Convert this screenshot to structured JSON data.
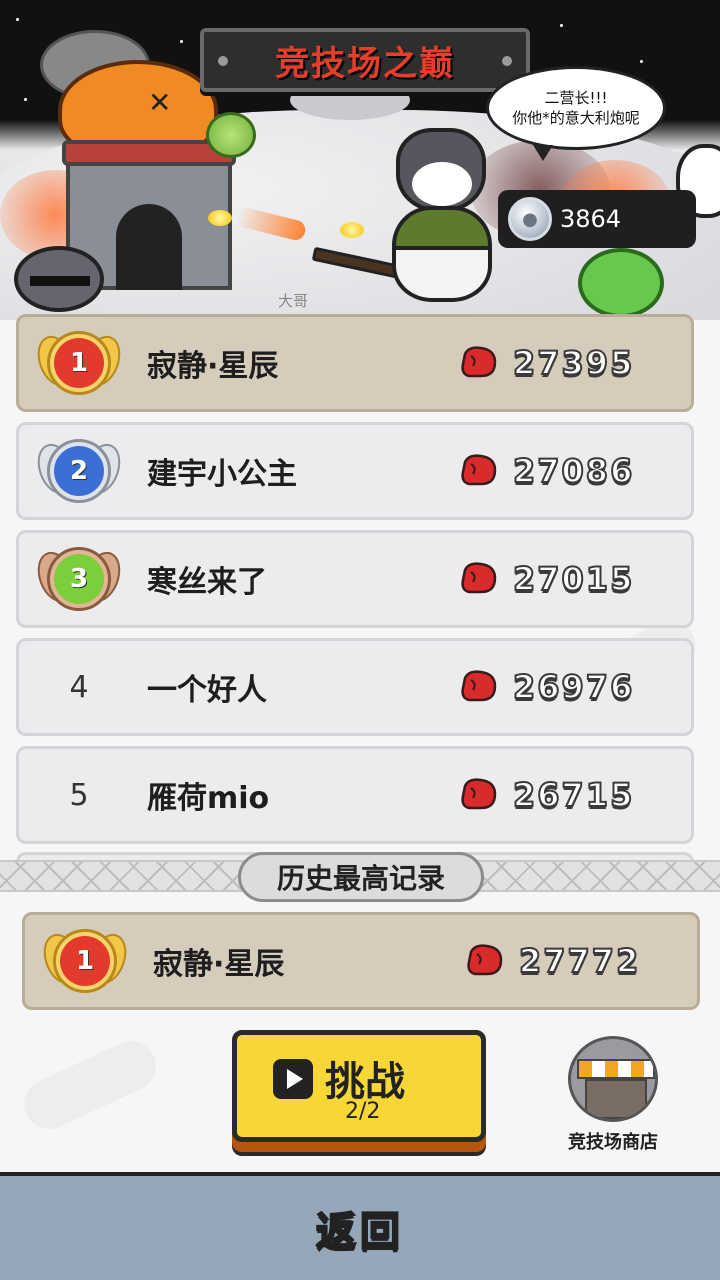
{
  "header": {
    "title": "竞技场之巅",
    "speech_line1": "二营长!!!",
    "speech_line2": "你他*的意大利炮呢",
    "character_label": "大哥"
  },
  "currency": {
    "icon": "silver-coin-icon",
    "value": "3864"
  },
  "ranking": [
    {
      "rank": "1",
      "name": "寂静·星辰",
      "score": "27395",
      "medal": "gold"
    },
    {
      "rank": "2",
      "name": "建宇小公主",
      "score": "27086",
      "medal": "silver"
    },
    {
      "rank": "3",
      "name": "寒丝来了",
      "score": "27015",
      "medal": "bronze"
    },
    {
      "rank": "4",
      "name": "一个好人",
      "score": "26976",
      "medal": null
    },
    {
      "rank": "5",
      "name": "雁荷mio",
      "score": "26715",
      "medal": null
    }
  ],
  "history": {
    "label": "历史最高记录",
    "record": {
      "rank": "1",
      "name": "寂静·星辰",
      "score": "27772",
      "medal": "gold"
    }
  },
  "challenge": {
    "label": "挑战",
    "count": "2/2",
    "icon": "play-icon"
  },
  "shop": {
    "label": "竞技场商店",
    "icon": "shop-stall-icon"
  },
  "footer": {
    "back_label": "返回"
  },
  "colors": {
    "gold": "#f2b318",
    "silver": "#3c6fd6",
    "bronze": "#7bcf3a",
    "title_red": "#e83d2a",
    "first_row": "#d6ccbc",
    "challenge_yellow": "#f7d736",
    "bottom_bar": "#96a7b9"
  }
}
